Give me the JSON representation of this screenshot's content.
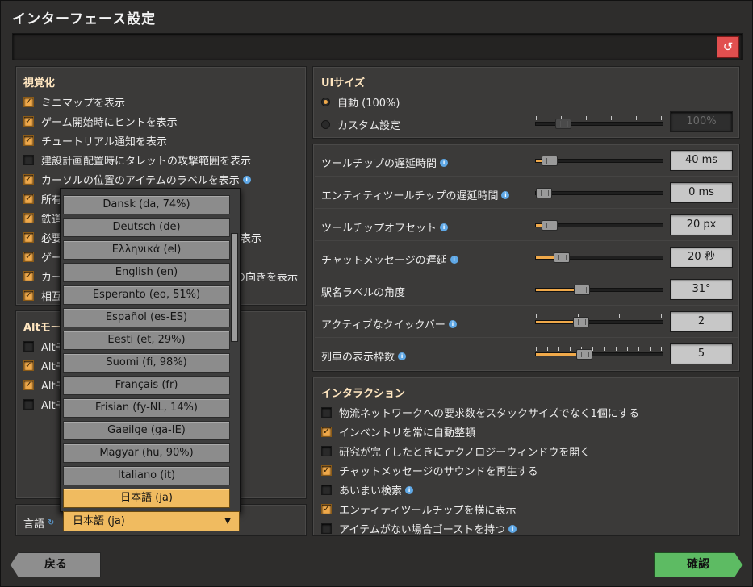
{
  "window": {
    "title": "インターフェース設定",
    "reset_icon": "undo-icon"
  },
  "visual": {
    "header": "視覚化",
    "items": [
      {
        "label": "ミニマップを表示",
        "checked": true,
        "info": false
      },
      {
        "label": "ゲーム開始時にヒントを表示",
        "checked": true,
        "info": false
      },
      {
        "label": "チュートリアル通知を表示",
        "checked": true,
        "info": false
      },
      {
        "label": "建設計画配置時にタレットの攻撃範囲を表示",
        "checked": false,
        "info": false
      },
      {
        "label": "カーソルの位置のアイテムのラベルを表示",
        "checked": true,
        "info": true
      },
      {
        "label": "所有",
        "checked": true,
        "info": false
      },
      {
        "label": "鉄道",
        "checked": true,
        "info": false
      },
      {
        "label": "必要",
        "checked": true,
        "info": false,
        "tail": "表示"
      },
      {
        "label": "ゲー",
        "checked": true,
        "info": false
      },
      {
        "label": "カー",
        "checked": true,
        "info": false,
        "tail": "の向きを表示"
      },
      {
        "label": "相互",
        "checked": true,
        "info": false
      }
    ]
  },
  "alt": {
    "header": "Altモー",
    "items": [
      {
        "label": "Altモ",
        "checked": false
      },
      {
        "label": "Altモ",
        "checked": true
      },
      {
        "label": "Altモ",
        "checked": true
      },
      {
        "label": "Altモ",
        "checked": false
      }
    ]
  },
  "language": {
    "label": "言語",
    "selected": "日本語 (ja)",
    "options": [
      "Dansk (da, 74%)",
      "Deutsch (de)",
      "Ελληνικά (el)",
      "English (en)",
      "Esperanto (eo, 51%)",
      "Español (es-ES)",
      "Eesti (et, 29%)",
      "Suomi (fi, 98%)",
      "Français (fr)",
      "Frisian (fy-NL, 14%)",
      "Gaeilge (ga-IE)",
      "Magyar (hu, 90%)",
      "Italiano (it)",
      "日本語 (ja)"
    ]
  },
  "ui_size": {
    "header": "UIサイズ",
    "options": [
      {
        "label": "自動 (100%)",
        "selected": true
      },
      {
        "label": "カスタム設定",
        "selected": false
      }
    ],
    "custom_value": "100%"
  },
  "sliders": [
    {
      "label": "ツールチップの遅延時間",
      "info": true,
      "value": "40 ms",
      "fraction": 0.05,
      "ticks": 0
    },
    {
      "label": "エンティティツールチップの遅延時間",
      "info": true,
      "value": "0 ms",
      "fraction": 0.0,
      "ticks": 0
    },
    {
      "label": "ツールチップオフセット",
      "info": true,
      "value": "20 px",
      "fraction": 0.05,
      "ticks": 0
    },
    {
      "label": "チャットメッセージの遅延",
      "info": true,
      "value": "20 秒",
      "fraction": 0.16,
      "ticks": 0
    },
    {
      "label": "駅名ラベルの角度",
      "info": false,
      "value": "31°",
      "fraction": 0.34,
      "ticks": 0
    },
    {
      "label": "アクティブなクイックバー",
      "info": true,
      "value": "2",
      "fraction": 0.33,
      "ticks": 4
    },
    {
      "label": "列車の表示枠数",
      "info": true,
      "value": "5",
      "fraction": 0.36,
      "ticks": 12
    }
  ],
  "interaction": {
    "header": "インタラクション",
    "items": [
      {
        "label": "物流ネットワークへの要求数をスタックサイズでなく1個にする",
        "checked": false,
        "info": false
      },
      {
        "label": "インベントリを常に自動整頓",
        "checked": true,
        "info": false
      },
      {
        "label": "研究が完了したときにテクノロジーウィンドウを開く",
        "checked": false,
        "info": false
      },
      {
        "label": "チャットメッセージのサウンドを再生する",
        "checked": true,
        "info": false
      },
      {
        "label": "あいまい検索",
        "checked": false,
        "info": true
      },
      {
        "label": "エンティティツールチップを横に表示",
        "checked": true,
        "info": false
      },
      {
        "label": "アイテムがない場合ゴーストを持つ",
        "checked": false,
        "info": true
      }
    ]
  },
  "footer": {
    "back_label": "戻る",
    "confirm_label": "確認"
  }
}
